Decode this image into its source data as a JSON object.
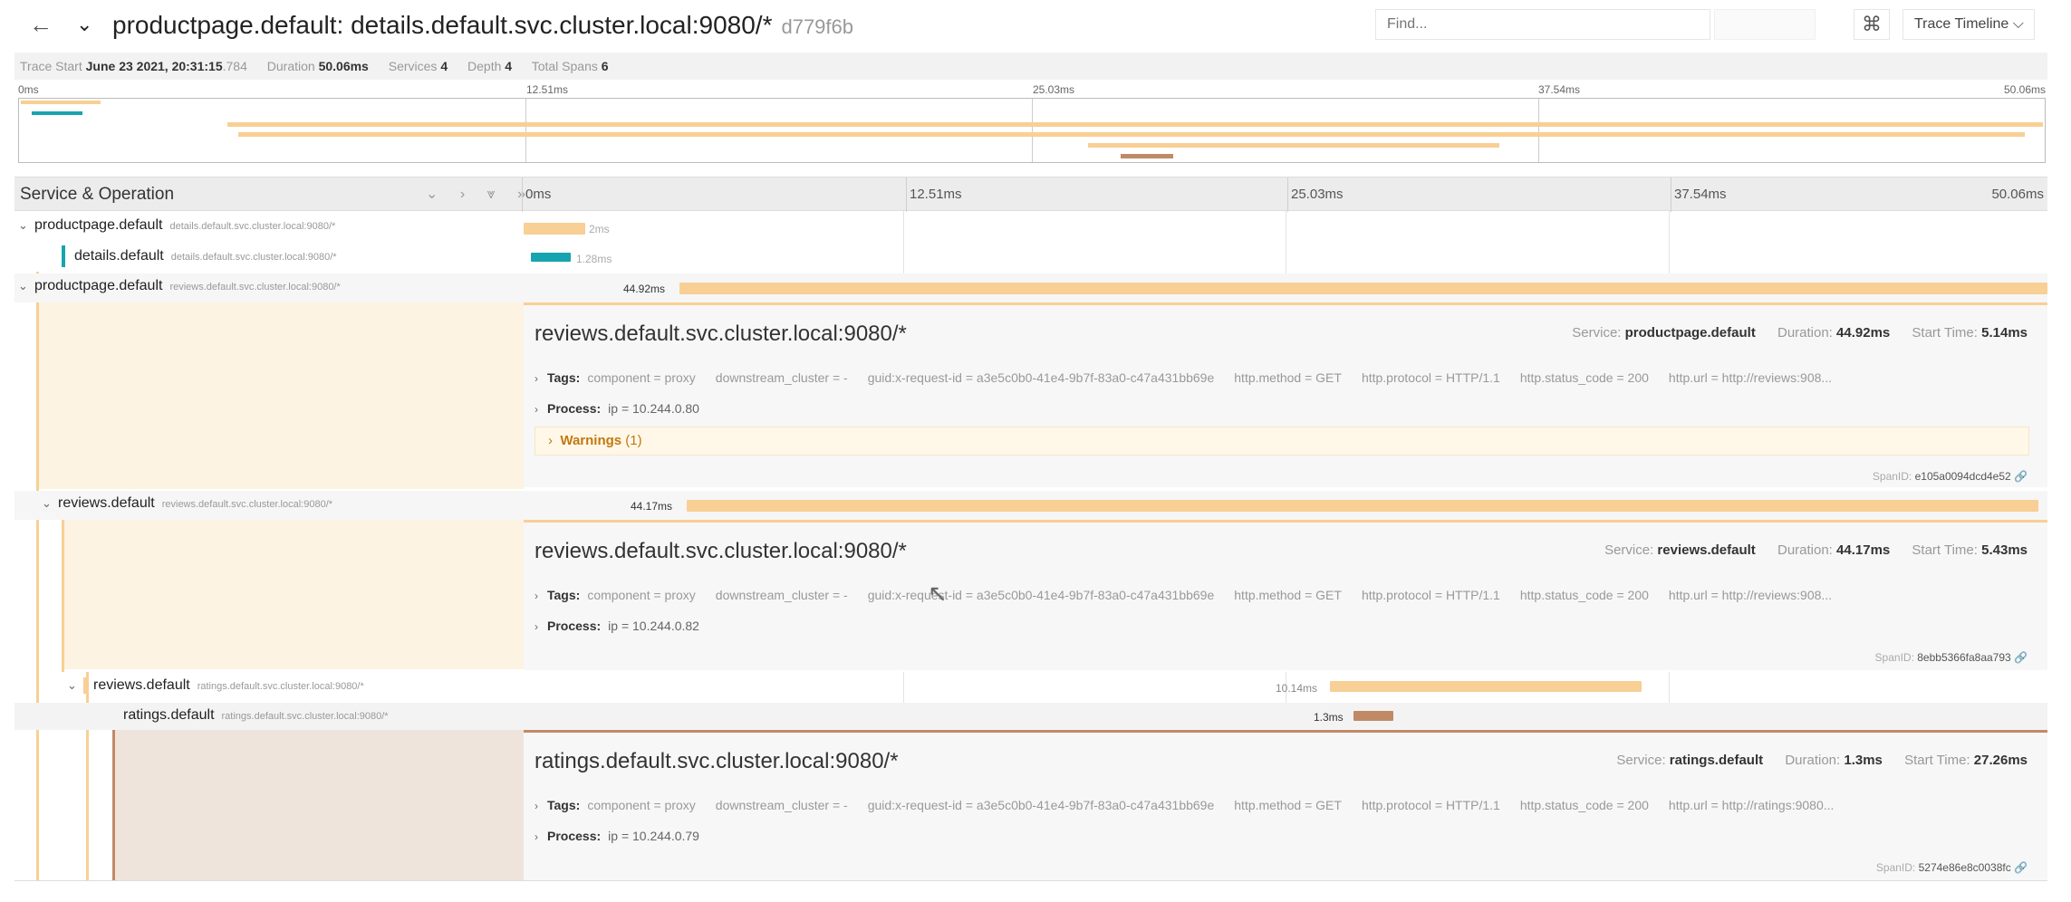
{
  "header": {
    "back_icon": "arrow-left-icon",
    "collapse_icon": "chevron-down-icon",
    "title": "productpage.default: details.default.svc.cluster.local:9080/*",
    "trace_id": "d779f6b",
    "find_placeholder": "Find...",
    "keyboard_icon": "command-icon",
    "view_select": "Trace Timeline ⌵"
  },
  "summary": {
    "trace_start_label": "Trace Start",
    "trace_start_value": "June 23 2021, 20:31:15",
    "trace_start_ms": ".784",
    "duration_label": "Duration",
    "duration_value": "50.06ms",
    "services_label": "Services",
    "services_value": "4",
    "depth_label": "Depth",
    "depth_value": "4",
    "total_spans_label": "Total Spans",
    "total_spans_value": "6"
  },
  "minimap": {
    "ticks": [
      "0ms",
      "12.51ms",
      "25.03ms",
      "37.54ms",
      "50.06ms"
    ]
  },
  "columns": {
    "service_operation": "Service & Operation",
    "controls": "⌄ › ⩔ »",
    "ticks": [
      "0ms",
      "12.51ms",
      "25.03ms",
      "37.54ms",
      "50.06ms"
    ]
  },
  "spans": [
    {
      "service": "productpage.default",
      "operation": "details.default.svc.cluster.local:9080/*",
      "duration": "2ms"
    },
    {
      "service": "details.default",
      "operation": "details.default.svc.cluster.local:9080/*",
      "duration": "1.28ms"
    },
    {
      "service": "productpage.default",
      "operation": "reviews.default.svc.cluster.local:9080/*",
      "duration": "44.92ms"
    },
    {
      "service": "reviews.default",
      "operation": "reviews.default.svc.cluster.local:9080/*",
      "duration": "44.17ms"
    },
    {
      "service": "reviews.default",
      "operation": "ratings.default.svc.cluster.local:9080/*",
      "duration": "10.14ms"
    },
    {
      "service": "ratings.default",
      "operation": "ratings.default.svc.cluster.local:9080/*",
      "duration": "1.3ms"
    }
  ],
  "details": [
    {
      "title": "reviews.default.svc.cluster.local:9080/*",
      "service_label": "Service:",
      "service": "productpage.default",
      "duration_label": "Duration:",
      "duration": "44.92ms",
      "start_label": "Start Time:",
      "start": "5.14ms",
      "tags_label": "Tags:",
      "tags": [
        "component = proxy",
        "downstream_cluster = -",
        "guid:x-request-id = a3e5c0b0-41e4-9b7f-83a0-c47a431bb69e",
        "http.method = GET",
        "http.protocol = HTTP/1.1",
        "http.status_code = 200",
        "http.url = http://reviews:908..."
      ],
      "process_label": "Process:",
      "process": "ip = 10.244.0.80",
      "warnings": "Warnings",
      "warnings_count": "(1)",
      "spanid_label": "SpanID:",
      "spanid": "e105a0094dcd4e52"
    },
    {
      "title": "reviews.default.svc.cluster.local:9080/*",
      "service_label": "Service:",
      "service": "reviews.default",
      "duration_label": "Duration:",
      "duration": "44.17ms",
      "start_label": "Start Time:",
      "start": "5.43ms",
      "tags_label": "Tags:",
      "tags": [
        "component = proxy",
        "downstream_cluster = -",
        "guid:x-request-id = a3e5c0b0-41e4-9b7f-83a0-c47a431bb69e",
        "http.method = GET",
        "http.protocol = HTTP/1.1",
        "http.status_code = 200",
        "http.url = http://reviews:908..."
      ],
      "process_label": "Process:",
      "process": "ip = 10.244.0.82",
      "spanid_label": "SpanID:",
      "spanid": "8ebb5366fa8aa793"
    },
    {
      "title": "ratings.default.svc.cluster.local:9080/*",
      "service_label": "Service:",
      "service": "ratings.default",
      "duration_label": "Duration:",
      "duration": "1.3ms",
      "start_label": "Start Time:",
      "start": "27.26ms",
      "tags_label": "Tags:",
      "tags": [
        "component = proxy",
        "downstream_cluster = -",
        "guid:x-request-id = a3e5c0b0-41e4-9b7f-83a0-c47a431bb69e",
        "http.method = GET",
        "http.protocol = HTTP/1.1",
        "http.status_code = 200",
        "http.url = http://ratings:9080..."
      ],
      "process_label": "Process:",
      "process": "ip = 10.244.0.79",
      "spanid_label": "SpanID:",
      "spanid": "5274e86e8c0038fc"
    }
  ],
  "colors": {
    "productpage": "#f8cf94",
    "details": "#17a4b0",
    "ratings": "#c08a66"
  }
}
